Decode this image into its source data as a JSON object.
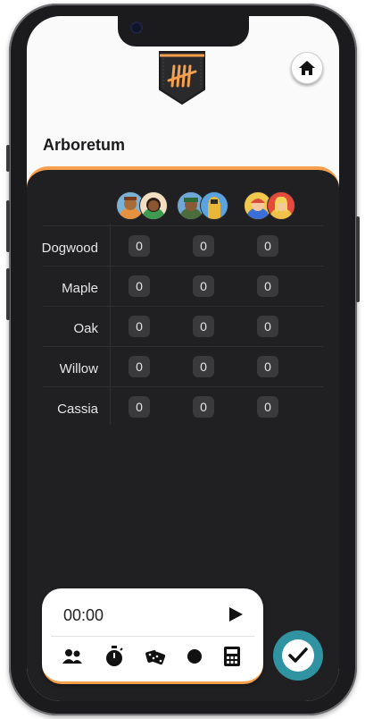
{
  "app": {
    "title": "Arboretum"
  },
  "colors": {
    "accent": "#f6a04d",
    "board": "#202022",
    "teal": "#2f93a1"
  },
  "header": {
    "logo_icon": "tally-marks-icon",
    "home_icon": "home-icon"
  },
  "players": [
    {
      "name_icon": "player-pair-1-avatars"
    },
    {
      "name_icon": "player-pair-2-avatars"
    },
    {
      "name_icon": "player-pair-3-avatars"
    }
  ],
  "rows": [
    {
      "label": "Dogwood",
      "scores": [
        "0",
        "0",
        "0"
      ]
    },
    {
      "label": "Maple",
      "scores": [
        "0",
        "0",
        "0"
      ]
    },
    {
      "label": "Oak",
      "scores": [
        "0",
        "0",
        "0"
      ]
    },
    {
      "label": "Willow",
      "scores": [
        "0",
        "0",
        "0"
      ]
    },
    {
      "label": "Cassia",
      "scores": [
        "0",
        "0",
        "0"
      ]
    }
  ],
  "timer": {
    "value": "00:00"
  },
  "toolbar": [
    "players-icon",
    "stopwatch-icon",
    "dice-icon",
    "dot-icon",
    "calculator-icon"
  ],
  "done_icon": "check-icon"
}
